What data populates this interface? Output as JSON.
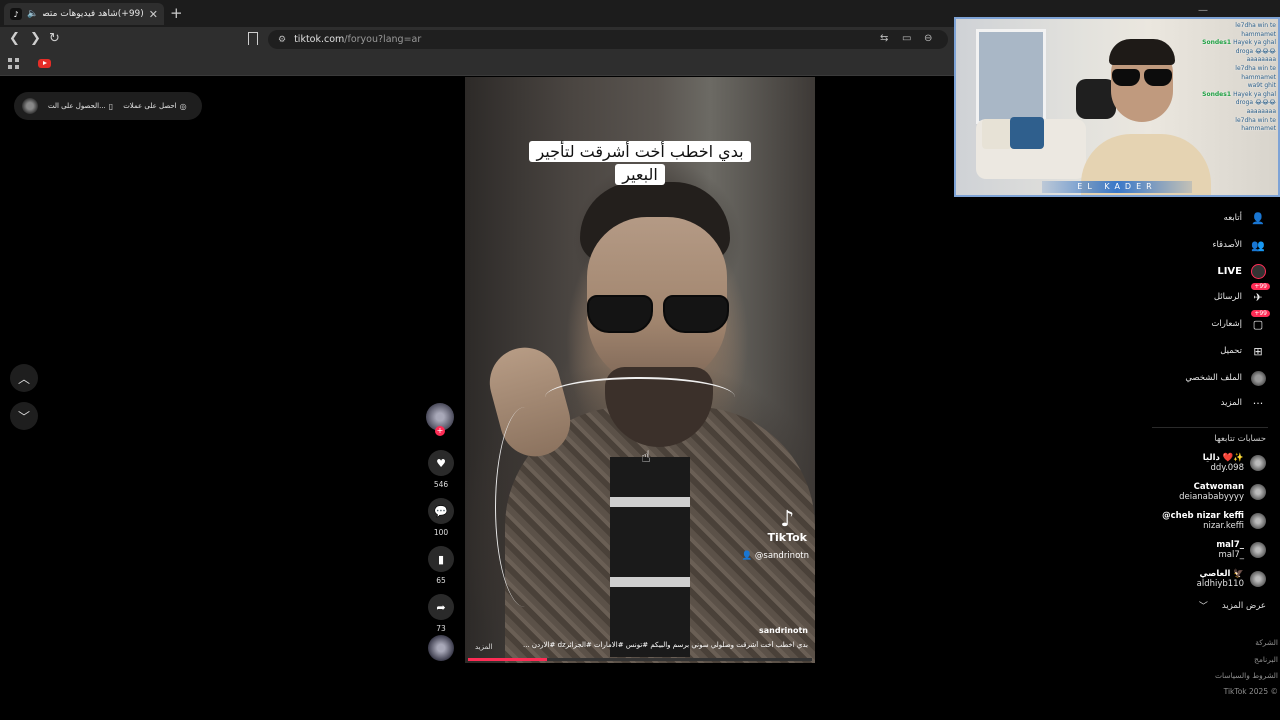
{
  "browser": {
    "tab_title": "(99+)شاهد فيديوهات متصدرة",
    "new_tab": "+",
    "close": "✕",
    "url_domain": "tiktok.com",
    "url_path": "/foryou?lang=ar"
  },
  "top_pill": {
    "item1": "احصل على عملات",
    "item2": "الحصول على الت..."
  },
  "video": {
    "caption_line1": "بدي اخطب أخت أشرقت لتأجير",
    "caption_line2": "البعير",
    "logo_text": "TikTok",
    "handle": "@sandrinotn",
    "author": "sandrinotn",
    "description": "بدي اخطب أخت أشرقت وصلولي سوني برسم والبيكم #تونس #الامارات #الجزائرdz #الاردن ...",
    "more": "المزيد",
    "progress": 0.23
  },
  "actions": {
    "likes": "546",
    "comments": "100",
    "saves": "65",
    "shares": "73"
  },
  "sidebar": {
    "items": [
      {
        "label": "أتابعه",
        "icon": "follow-icon"
      },
      {
        "label": "الأصدقاء",
        "icon": "friends-icon"
      },
      {
        "label": "LIVE",
        "icon": "live-icon"
      },
      {
        "label": "الرسائل",
        "icon": "messages-icon",
        "badge": "99+"
      },
      {
        "label": "إشعارات",
        "icon": "notifications-icon",
        "badge": "99+"
      },
      {
        "label": "تحميل",
        "icon": "upload-icon"
      },
      {
        "label": "الملف الشخصي",
        "icon": "profile-icon"
      },
      {
        "label": "المزيد",
        "icon": "more-icon"
      }
    ],
    "following_title": "حسابات تتابعها",
    "accounts": [
      {
        "name": "داليا ❤️✨",
        "user": "ddy.098"
      },
      {
        "name": "Catwoman",
        "user": "deianababyyyy"
      },
      {
        "name": "@cheb nizar keffi",
        "user": "nizar.keffi"
      },
      {
        "name": "mal7_",
        "user": "mal7_"
      },
      {
        "name": "العاصي 🦅",
        "user": "aldhiyb110"
      }
    ],
    "see_more": "عرض المزيد",
    "footer": [
      "الشركة",
      "البرنامج",
      "الشروط والسياسات",
      "© TikTok 2025"
    ]
  },
  "stream": {
    "brand": "EL KADER",
    "chat": [
      {
        "user": "",
        "text": "le7dha win te"
      },
      {
        "user": "",
        "text": "hammamet"
      },
      {
        "user": "Sondes1",
        "text": "Hayek ya ghal"
      },
      {
        "user": "",
        "text": "droga 😂😂😂"
      },
      {
        "user": "",
        "text": "aaaaaaaa"
      },
      {
        "user": "",
        "text": "le7dha win te"
      },
      {
        "user": "",
        "text": "hammamet"
      },
      {
        "user": "",
        "text": "wa9t ghit"
      },
      {
        "user": "Sondes1",
        "text": "Hayek ya ghal"
      },
      {
        "user": "",
        "text": "droga 😂😂😂"
      },
      {
        "user": "",
        "text": "aaaaaaaa"
      },
      {
        "user": "",
        "text": "le7dha win te"
      },
      {
        "user": "",
        "text": "hammamet"
      }
    ]
  }
}
